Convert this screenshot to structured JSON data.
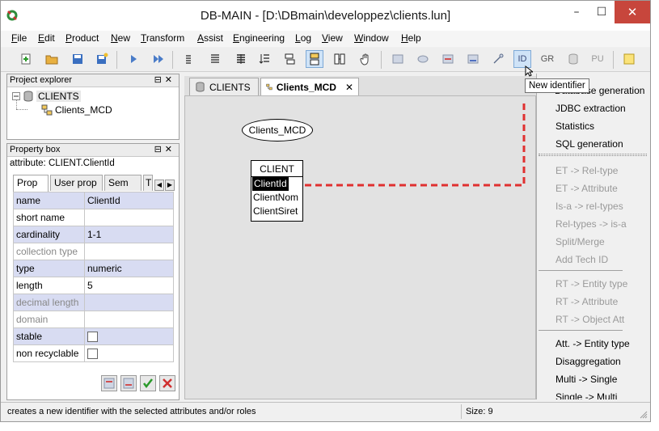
{
  "window": {
    "title": "DB-MAIN  - [D:\\DBmain\\developpez\\clients.lun]",
    "minimize": "–",
    "maximize": "☐",
    "close": "✕"
  },
  "menu": [
    {
      "label": "File",
      "u": "F",
      "rest": "ile"
    },
    {
      "label": "Edit",
      "u": "E",
      "rest": "dit"
    },
    {
      "label": "Product",
      "u": "P",
      "rest": "roduct"
    },
    {
      "label": "New",
      "u": "N",
      "rest": "ew"
    },
    {
      "label": "Transform",
      "u": "T",
      "rest": "ransform"
    },
    {
      "label": "Assist",
      "u": "A",
      "rest": "ssist"
    },
    {
      "label": "Engineering",
      "u": "E",
      "rest": "ngineering"
    },
    {
      "label": "Log",
      "u": "L",
      "rest": "og"
    },
    {
      "label": "View",
      "u": "V",
      "rest": "iew"
    },
    {
      "label": "Window",
      "u": "W",
      "rest": "indow"
    },
    {
      "label": "Help",
      "u": "H",
      "rest": "elp"
    }
  ],
  "toolbar": {
    "id_label": "ID",
    "gr_label": "GR",
    "pu_label": "PU"
  },
  "project_explorer": {
    "title": "Project explorer",
    "controls": "⊟✕",
    "root": "CLIENTS",
    "child": "Clients_MCD"
  },
  "property_box": {
    "title": "Property box",
    "controls": "⊟✕",
    "subject": "attribute: CLIENT.ClientId",
    "tabs": [
      "Prop",
      "User prop",
      "Sem",
      "T"
    ],
    "rows": [
      {
        "key": "name",
        "value": "ClientId",
        "shade": true,
        "dim": false,
        "check": false
      },
      {
        "key": "short name",
        "value": "",
        "shade": false,
        "dim": false,
        "check": false
      },
      {
        "key": "cardinality",
        "value": "1-1",
        "shade": true,
        "dim": false,
        "check": false
      },
      {
        "key": "collection type",
        "value": "",
        "shade": false,
        "dim": true,
        "check": false
      },
      {
        "key": "type",
        "value": "numeric",
        "shade": true,
        "dim": false,
        "check": false
      },
      {
        "key": "length",
        "value": "5",
        "shade": false,
        "dim": false,
        "check": false
      },
      {
        "key": "decimal length",
        "value": "",
        "shade": true,
        "dim": true,
        "check": false
      },
      {
        "key": "domain",
        "value": "",
        "shade": false,
        "dim": true,
        "check": false
      },
      {
        "key": "stable",
        "value": "",
        "shade": true,
        "dim": false,
        "check": true
      },
      {
        "key": "non recyclable",
        "value": "",
        "shade": false,
        "dim": false,
        "check": true
      }
    ]
  },
  "editor_tabs": [
    {
      "label": "CLIENTS",
      "selected": false
    },
    {
      "label": "Clients_MCD",
      "selected": true,
      "close": "✕"
    }
  ],
  "diagram": {
    "schema_name": "Clients_MCD",
    "entity": {
      "name": "CLIENT",
      "attributes": [
        "ClientId",
        "ClientNom",
        "ClientSiret"
      ]
    },
    "link_color": "#e03030"
  },
  "tooltip": "New identifier",
  "assist_panel": {
    "top_items": [
      "Database generation",
      "JDBC extraction",
      "Statistics",
      "SQL generation"
    ],
    "group1": [
      "ET -> Rel-type",
      "ET -> Attribute",
      "Is-a -> rel-types",
      "Rel-types -> is-a",
      "Split/Merge",
      "Add Tech ID"
    ],
    "group2": [
      "RT -> Entity type",
      "RT -> Attribute",
      "RT -> Object Att"
    ],
    "group3": [
      "Att. -> Entity type",
      "Disaggregation",
      "Multi -> Single",
      "Single -> Multi"
    ]
  },
  "status": {
    "message": "creates a new identifier with the selected attributes and/or roles",
    "size": "Size: 9"
  }
}
